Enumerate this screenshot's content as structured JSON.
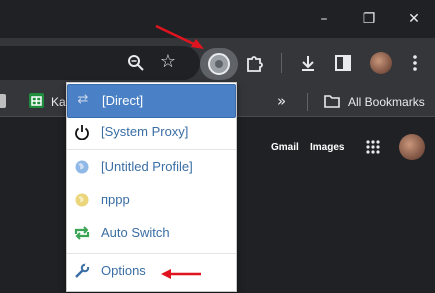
{
  "bookmarks": {
    "item1_label": "Ka",
    "all_bookmarks_label": "All Bookmarks"
  },
  "google_bar": {
    "gmail_label": "Gmail",
    "images_label": "Images"
  },
  "proxy_menu": {
    "items": [
      {
        "label": "[Direct]",
        "icon": "arrows-icon"
      },
      {
        "label": "[System Proxy]",
        "icon": "power-icon"
      },
      {
        "label": "[Untitled Profile]",
        "icon": "globe-icon"
      },
      {
        "label": "пррр",
        "icon": "globe-icon"
      },
      {
        "label": "Auto Switch",
        "icon": "refresh-icon"
      },
      {
        "label": "Options",
        "icon": "wrench-icon"
      }
    ]
  },
  "colors": {
    "selected_bg": "#4a80c5",
    "label_color": "#3a6ea5",
    "annotation_arrow": "#e0141e"
  }
}
